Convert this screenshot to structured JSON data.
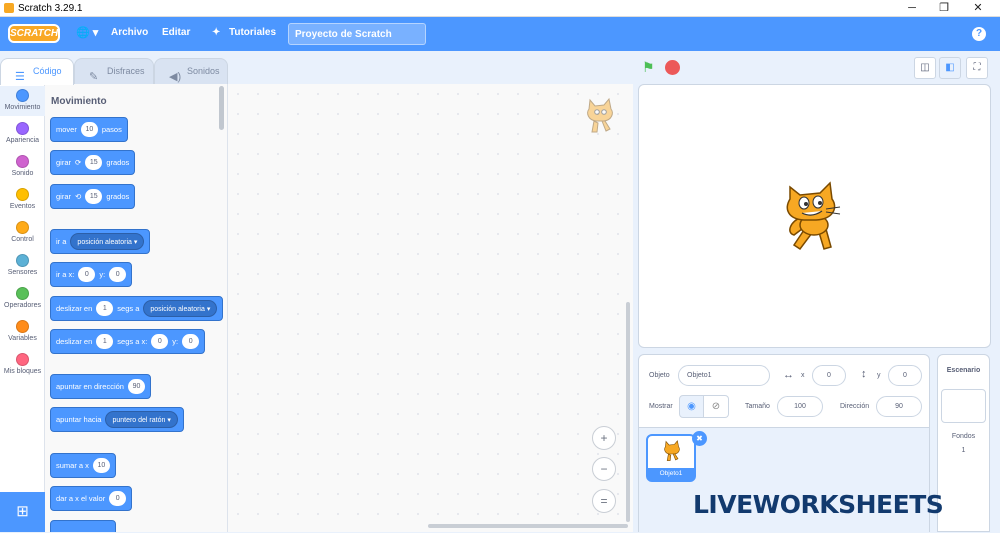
{
  "window": {
    "title": "Scratch 3.29.1",
    "minimize": "─",
    "maximize": "❐",
    "close": "✕"
  },
  "menubar": {
    "logo": "SCRATCH",
    "globe": "🌐 ▾",
    "file": "Archivo",
    "edit": "Editar",
    "tutorials": "Tutoriales",
    "project_name": "Proyecto de Scratch",
    "help": "?"
  },
  "tabs": {
    "code": "Código",
    "costumes": "Disfraces",
    "sounds": "Sonidos"
  },
  "categories": [
    {
      "label": "Movimiento",
      "color": "#4c97ff"
    },
    {
      "label": "Apariencia",
      "color": "#9966ff"
    },
    {
      "label": "Sonido",
      "color": "#cf63cf"
    },
    {
      "label": "Eventos",
      "color": "#ffbf00"
    },
    {
      "label": "Control",
      "color": "#ffab19"
    },
    {
      "label": "Sensores",
      "color": "#5cb1d6"
    },
    {
      "label": "Operadores",
      "color": "#59c059"
    },
    {
      "label": "Variables",
      "color": "#ff8c1a"
    },
    {
      "label": "Mis bloques",
      "color": "#ff6680"
    }
  ],
  "palette": {
    "heading": "Movimiento",
    "move": {
      "pre": "mover",
      "val": "10",
      "post": "pasos"
    },
    "turn_right": {
      "pre": "girar",
      "icon": "⟳",
      "val": "15",
      "post": "grados"
    },
    "turn_left": {
      "pre": "girar",
      "icon": "⟲",
      "val": "15",
      "post": "grados"
    },
    "goto": {
      "pre": "ir a",
      "dd": "posición aleatoria ▾"
    },
    "goto_xy": {
      "pre": "ir a x:",
      "x": "0",
      "mid": "y:",
      "y": "0"
    },
    "glide": {
      "pre": "deslizar en",
      "val": "1",
      "mid": "segs a",
      "dd": "posición aleatoria ▾"
    },
    "glide_xy": {
      "pre": "deslizar en",
      "val": "1",
      "mid": "segs a x:",
      "x": "0",
      "mid2": "y:",
      "y": "0"
    },
    "point_dir": {
      "pre": "apuntar en dirección",
      "val": "90"
    },
    "point_to": {
      "pre": "apuntar hacia",
      "dd": "puntero del ratón ▾"
    },
    "change_x": {
      "pre": "sumar a x",
      "val": "10"
    },
    "set_x": {
      "pre": "dar a x el valor",
      "val": "0"
    }
  },
  "zoom": {
    "in": "+",
    "out": "−",
    "reset": "="
  },
  "stage_controls": {
    "green_flag": "⚑",
    "stop": "●",
    "small": "◫",
    "normal": "◧",
    "fullscreen": "⛶"
  },
  "sprite_info": {
    "sprite_label": "Objeto",
    "sprite_name": "Objeto1",
    "x_label": "x",
    "x_value": "0",
    "y_label": "y",
    "y_value": "0",
    "show_label": "Mostrar",
    "size_label": "Tamaño",
    "size_value": "100",
    "direction_label": "Dirección",
    "direction_value": "90"
  },
  "sprite_list": [
    {
      "name": "Objeto1"
    }
  ],
  "stage_pane": {
    "title": "Escenario",
    "backdrops_label": "Fondos",
    "backdrops_count": "1"
  },
  "watermark": "LIVEWORKSHEETS"
}
